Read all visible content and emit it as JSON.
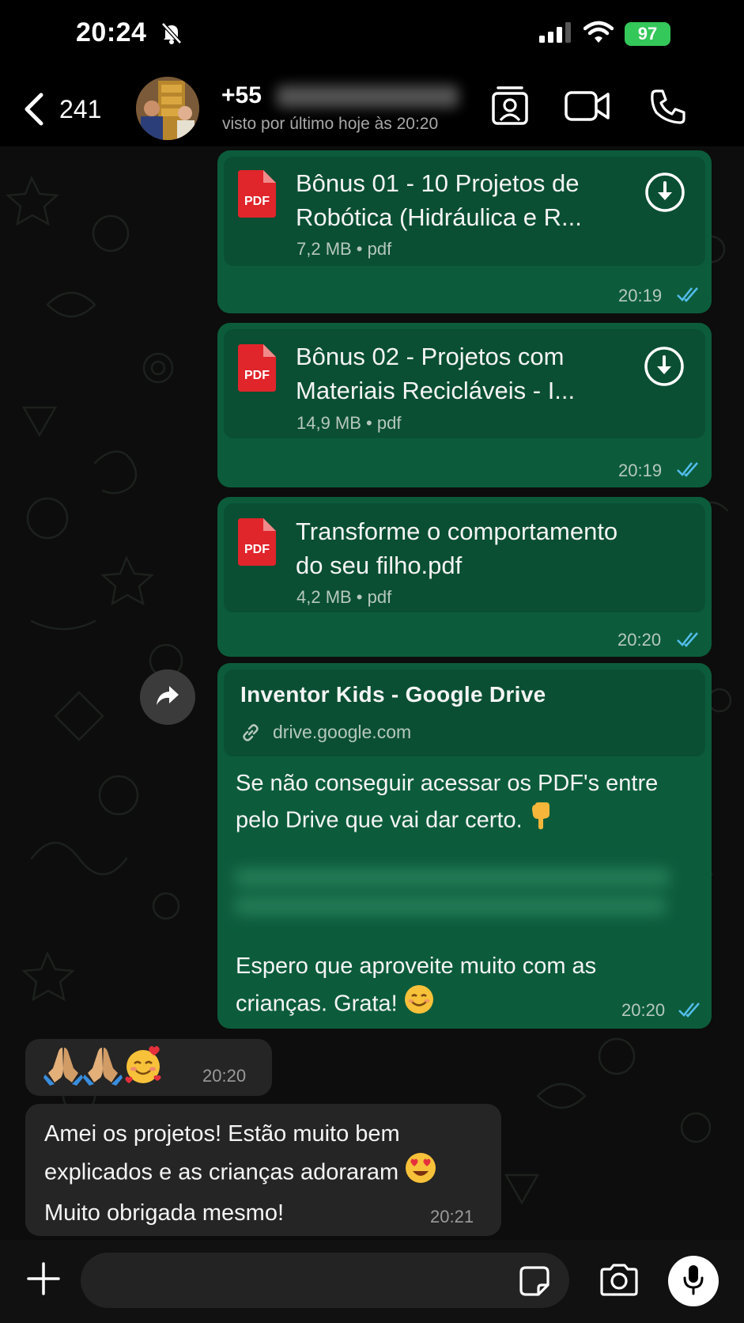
{
  "status_bar": {
    "time": "20:24",
    "battery": "97"
  },
  "header": {
    "back_count": "241",
    "contact_name": "+55",
    "last_seen": "visto por último hoje às 20:20"
  },
  "messages": [
    {
      "type": "document",
      "title_line1": "Bônus 01 - 10 Projetos de",
      "title_line2": "Robótica (Hidráulica e R...",
      "meta": "7,2 MB • pdf",
      "time": "20:19",
      "icon": "pdf-icon"
    },
    {
      "type": "document",
      "title_line1": "Bônus 02 - Projetos com",
      "title_line2": "Materiais Recicláveis - I...",
      "meta": "14,9 MB • pdf",
      "time": "20:19",
      "icon": "pdf-icon"
    },
    {
      "type": "document",
      "title_line1": "Transforme o comportamento",
      "title_line2": "do seu filho.pdf",
      "meta": "4,2 MB • pdf",
      "time": "20:20",
      "icon": "pdf-icon"
    },
    {
      "type": "link",
      "preview_title": "Inventor Kids - Google Drive",
      "preview_domain": "drive.google.com",
      "text_line1": "Se não conseguir acessar os PDF's entre",
      "text_line2": "pelo Drive que vai dar certo.",
      "text_line3": "Espero que aproveite muito com as",
      "text_line4": "crianças. Grata!",
      "time": "20:20"
    },
    {
      "type": "reaction",
      "emoji": "🙏🏼🙏🏼🥰",
      "time": "20:20"
    },
    {
      "type": "incoming_text",
      "text_line1": "Amei os projetos! Estão muito bem",
      "text_line2": "explicados e as crianças adoraram",
      "text_line3": "Muito obrigada mesmo!",
      "time": "20:21"
    }
  ],
  "input": {
    "placeholder": ""
  },
  "colors": {
    "outgoing_bubble": "#0c5c3c",
    "incoming_bubble": "#252525",
    "read_ticks": "#53bdeb",
    "pdf_red": "#e0252b"
  }
}
